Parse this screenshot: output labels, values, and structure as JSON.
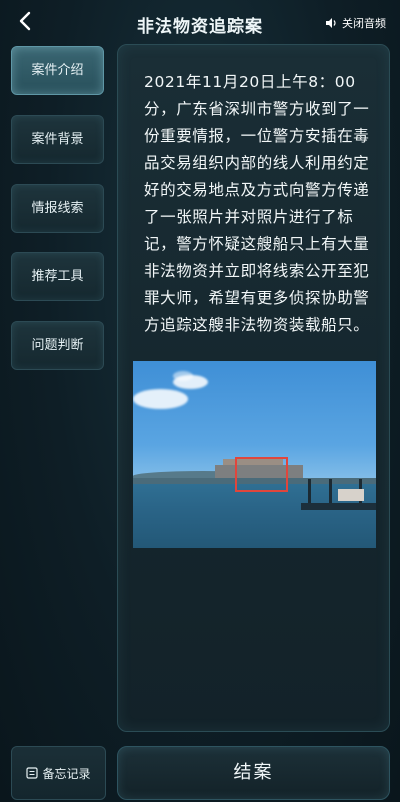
{
  "header": {
    "back_icon": "chevron-left-icon",
    "title": "非法物资追踪案",
    "audio_label": "关闭音频",
    "audio_icon": "speaker-icon"
  },
  "sidebar": {
    "items": [
      {
        "label": "案件介绍",
        "active": true
      },
      {
        "label": "案件背景",
        "active": false
      },
      {
        "label": "情报线索",
        "active": false
      },
      {
        "label": "推荐工具",
        "active": false
      },
      {
        "label": "问题判断",
        "active": false
      }
    ]
  },
  "content": {
    "text": "2021年11月20日上午8：00分，广东省深圳市警方收到了一份重要情报，一位警方安插在毒品交易组织内部的线人利用约定好的交易地点及方式向警方传递了一张照片并对照片进行了标记，警方怀疑这艘船只上有大量非法物资并立即将线索公开至犯罪大师，希望有更多侦探协助警方追踪这艘非法物资装载船只。",
    "photo_marker_color": "#e0463c"
  },
  "footer": {
    "memo_label": "备忘记录",
    "memo_icon": "memo-icon",
    "close_case_label": "结案"
  },
  "colors": {
    "accent": "#5f97a6",
    "background": "#0e1e26"
  }
}
